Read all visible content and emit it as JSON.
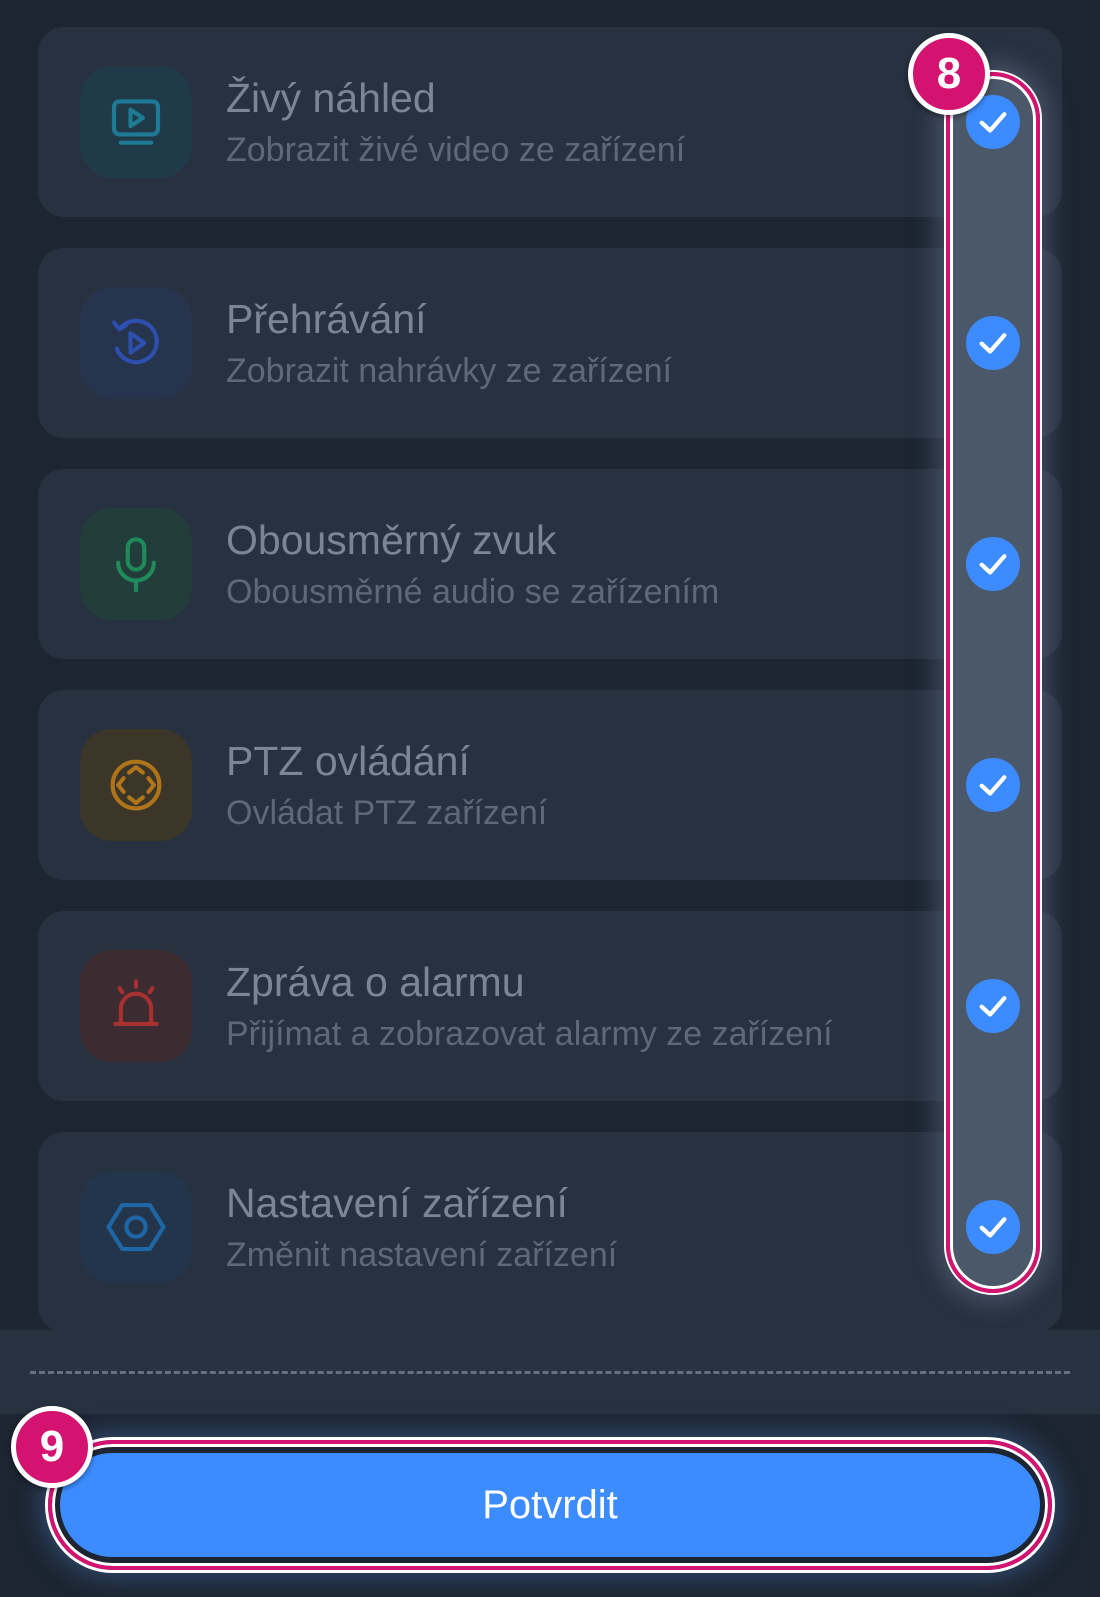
{
  "permissions": [
    {
      "title": "Živý náhled",
      "description": "Zobrazit živé video ze zařízení",
      "icon": "live-view-icon",
      "icon_color": "#1e7b96",
      "icon_bg": "#213a4a",
      "checked": true
    },
    {
      "title": "Přehrávání",
      "description": "Zobrazit nahrávky ze zařízení",
      "icon": "playback-icon",
      "icon_color": "#2d4fb0",
      "icon_bg": "#27344d",
      "checked": true
    },
    {
      "title": "Obousměrný zvuk",
      "description": "Obousměrné audio se zařízením",
      "icon": "microphone-icon",
      "icon_color": "#1f8a5a",
      "icon_bg": "#223d3a",
      "checked": true
    },
    {
      "title": "PTZ ovládání",
      "description": "Ovládat PTZ zařízení",
      "icon": "ptz-control-icon",
      "icon_color": "#b0741a",
      "icon_bg": "#3b3628",
      "checked": true
    },
    {
      "title": "Zpráva o alarmu",
      "description": "Přijímat a zobrazovat alarmy ze zařízení",
      "icon": "alarm-icon",
      "icon_color": "#a8302f",
      "icon_bg": "#3c2b31",
      "checked": true
    },
    {
      "title": "Nastavení zařízení",
      "description": "Změnit nastavení zařízení",
      "icon": "settings-icon",
      "icon_color": "#1e66a6",
      "icon_bg": "#22354a",
      "checked": true
    }
  ],
  "confirm_label": "Potvrdit",
  "step_badges": {
    "checks": "8",
    "confirm": "9"
  },
  "colors": {
    "accent": "#3d8cff",
    "highlight_outline": "#d4126f",
    "background": "#1c2531",
    "card": "#273140"
  }
}
